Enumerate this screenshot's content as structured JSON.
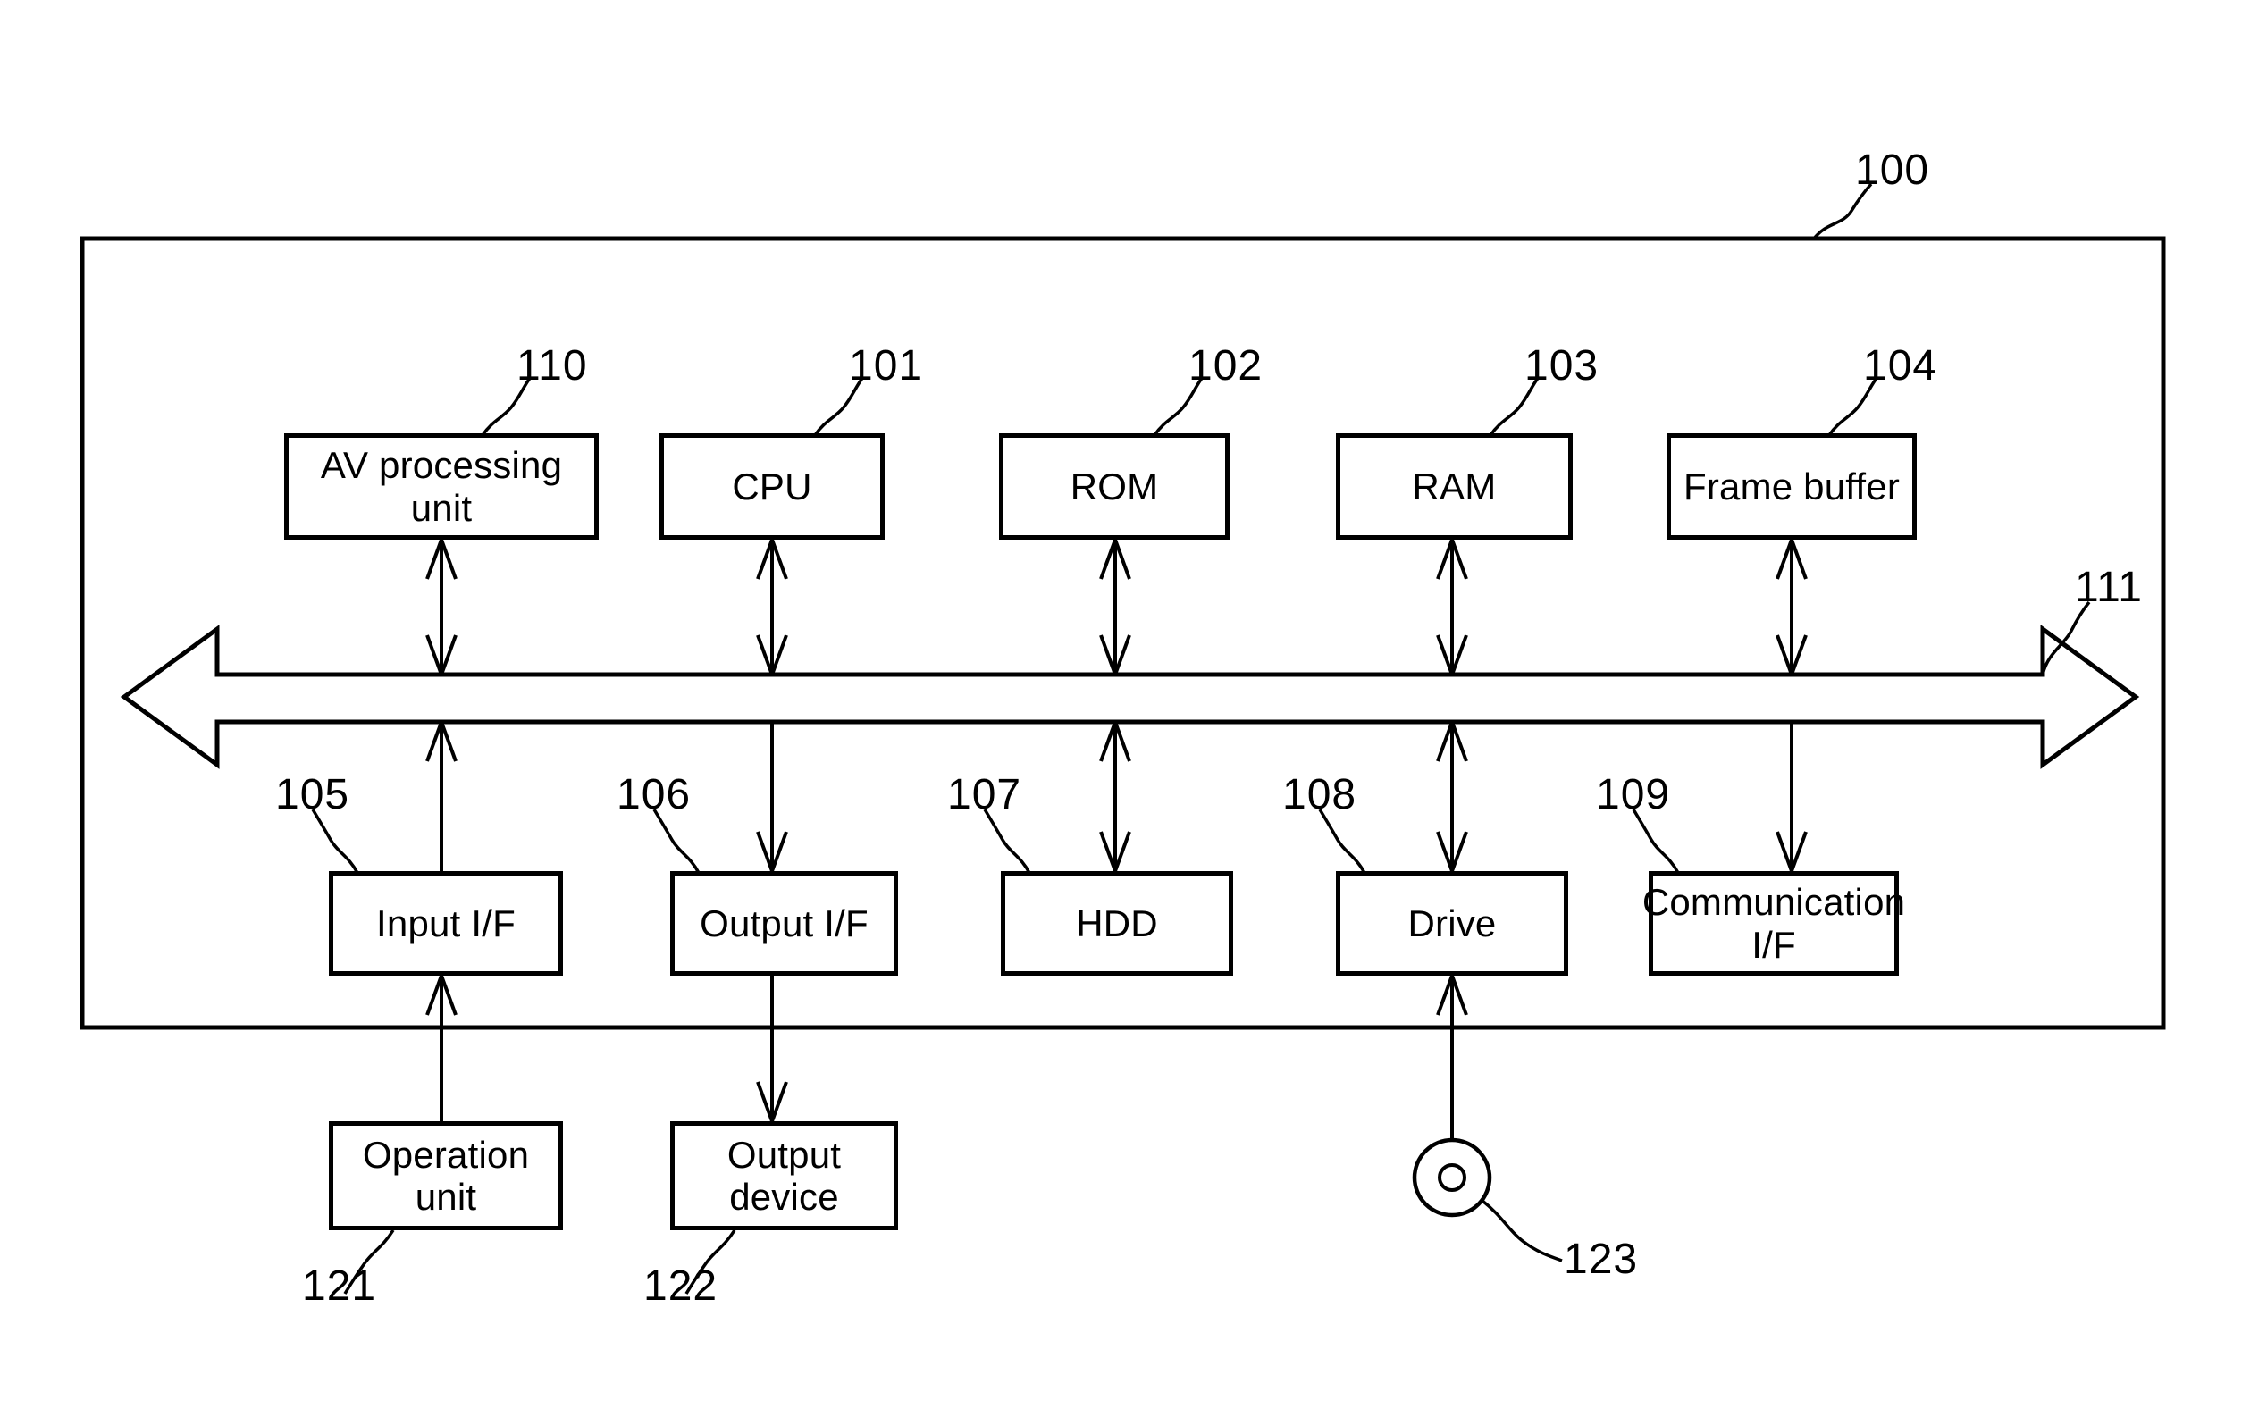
{
  "figure": {
    "kind": "patent-block-diagram",
    "stroke_color": "#000000",
    "background_color": "#ffffff"
  },
  "system": {
    "ref": "100",
    "label": "system-enclosure"
  },
  "bus": {
    "ref": "111",
    "label": "bus",
    "style": "double-headed-hollow-arrow"
  },
  "top_row": [
    {
      "ref": "110",
      "name": "av-processing-unit",
      "line1": "AV processing",
      "line2": "unit"
    },
    {
      "ref": "101",
      "name": "cpu",
      "line1": "CPU",
      "line2": ""
    },
    {
      "ref": "102",
      "name": "rom",
      "line1": "ROM",
      "line2": ""
    },
    {
      "ref": "103",
      "name": "ram",
      "line1": "RAM",
      "line2": ""
    },
    {
      "ref": "104",
      "name": "frame-buffer",
      "line1": "Frame buffer",
      "line2": ""
    }
  ],
  "bottom_row": [
    {
      "ref": "105",
      "name": "input-if",
      "line1": "Input I/F",
      "line2": ""
    },
    {
      "ref": "106",
      "name": "output-if",
      "line1": "Output I/F",
      "line2": ""
    },
    {
      "ref": "107",
      "name": "hdd",
      "line1": "HDD",
      "line2": ""
    },
    {
      "ref": "108",
      "name": "drive",
      "line1": "Drive",
      "line2": ""
    },
    {
      "ref": "109",
      "name": "communication-if",
      "line1": "Communication",
      "line2": "I/F"
    }
  ],
  "external": [
    {
      "ref": "121",
      "name": "operation-unit",
      "line1": "Operation",
      "line2": "unit"
    },
    {
      "ref": "122",
      "name": "output-device",
      "line1": "Output",
      "line2": "device"
    }
  ],
  "media": {
    "ref": "123",
    "name": "removable-disc"
  }
}
